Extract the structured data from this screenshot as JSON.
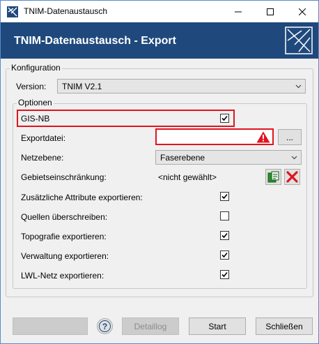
{
  "window": {
    "title": "TNIM-Datenaustausch",
    "banner_title": "TNIM-Datenaustausch - Export"
  },
  "konfiguration": {
    "legend": "Konfiguration",
    "version_label": "Version:",
    "version_value": "TNIM V2.1"
  },
  "optionen": {
    "legend": "Optionen",
    "gis_nb_label": "GIS-NB",
    "gis_nb_checked": true,
    "exportdatei_label": "Exportdatei:",
    "exportdatei_value": "",
    "browse_label": "...",
    "netzebene_label": "Netzebene:",
    "netzebene_value": "Faserebene",
    "gebiet_label": "Gebietseinschränkung:",
    "gebiet_value": "<nicht gewählt>",
    "options": [
      {
        "label": "Zusätzliche Attribute exportieren:",
        "checked": true
      },
      {
        "label": "Quellen überschreiben:",
        "checked": false
      },
      {
        "label": "Topografie exportieren:",
        "checked": true
      },
      {
        "label": "Verwaltung exportieren:",
        "checked": true
      },
      {
        "label": "LWL-Netz exportieren:",
        "checked": true
      }
    ]
  },
  "footer": {
    "help_label": "?",
    "detaillog_label": "Detaillog",
    "start_label": "Start",
    "close_label": "Schließen"
  },
  "colors": {
    "banner": "#1f497d",
    "error_red": "#e0141e"
  }
}
